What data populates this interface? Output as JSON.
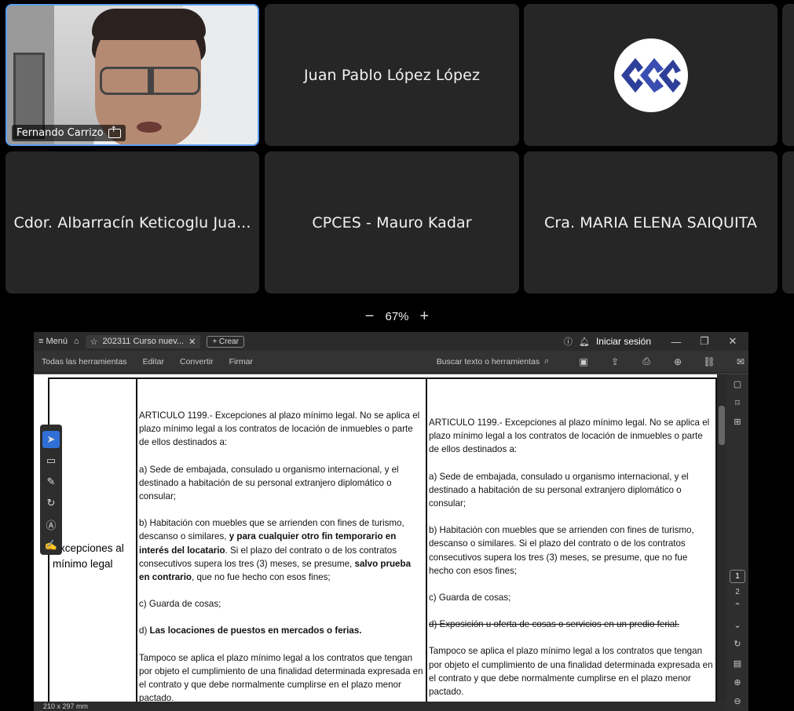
{
  "gallery": {
    "tiles": [
      {
        "name": "Fernando Carrizo"
      },
      {
        "name": "Juan Pablo López López"
      },
      {
        "name": ""
      },
      {
        "name": "Cdor. Albarracín Keticoglu Jua..."
      },
      {
        "name": "CPCES - Mauro Kadar"
      },
      {
        "name": "Cra. MARIA ELENA SAIQUITA"
      }
    ],
    "zoom": {
      "minus": "−",
      "level": "67%",
      "plus": "+"
    }
  },
  "viewer": {
    "titlebar": {
      "menu": "≡ Menú",
      "tab_title": "202311 Curso nuev...",
      "create": "+ Crear",
      "login": "Iniciar sesión"
    },
    "menubar": {
      "items": [
        "Todas las herramientas",
        "Editar",
        "Convertir",
        "Firmar"
      ],
      "search_placeholder": "Buscar texto o herramientas"
    },
    "doc": {
      "row_label": "Excepciones al mínimo legal",
      "left": {
        "p1": "ARTICULO 1199.- Excepciones al plazo mínimo legal. No se aplica el plazo mínimo legal a los contratos de locación de inmuebles o parte de ellos destinados a:",
        "p2": "a) Sede de embajada, consulado u organismo internacional, y el destinado a habitación de su personal extranjero diplomático o consular;",
        "p3a": "b) Habitación con muebles que se arrienden con fines de turismo, descanso o similares, ",
        "p3b": "y para cualquier otro fin temporario en interés del locatario",
        "p3c": ". Si el plazo del contrato o de los contratos consecutivos supera los tres (3) meses, se presume, ",
        "p3d": "salvo prueba en contrario",
        "p3e": ", que no fue hecho con esos fines;",
        "p4": "c) Guarda de cosas;",
        "p5a": "d) ",
        "p5b": "Las locaciones de puestos en mercados o ferias.",
        "p6": "Tampoco se aplica el plazo mínimo legal a los contratos que tengan por objeto el cumplimiento de una finalidad determinada expresada en el contrato y que debe normalmente cumplirse en el plazo menor pactado."
      },
      "right": {
        "p1": "ARTICULO 1199.- Excepciones al plazo mínimo legal. No se aplica el plazo mínimo legal a los contratos de locación de inmuebles o parte de ellos destinados a:",
        "p2": "a) Sede de embajada, consulado u organismo internacional, y el destinado a habitación de su personal extranjero diplomático o consular;",
        "p3": "b) Habitación con muebles que se arrienden con fines de turismo, descanso o similares. Si el plazo del contrato o de los contratos consecutivos supera los tres (3) meses, se presume, que no fue hecho con esos fines;",
        "p4": "c) Guarda de cosas;",
        "p5": "d) Exposición u oferta de cosas o servicios en un predio ferial.",
        "p6": "Tampoco se aplica el plazo mínimo legal a los contratos que tengan por objeto el cumplimiento de una finalidad determinada expresada en el contrato y que debe normalmente cumplirse en el plazo menor pactado."
      }
    },
    "pages": {
      "current": "1",
      "next": "2"
    },
    "status": "210 x 297 mm"
  }
}
